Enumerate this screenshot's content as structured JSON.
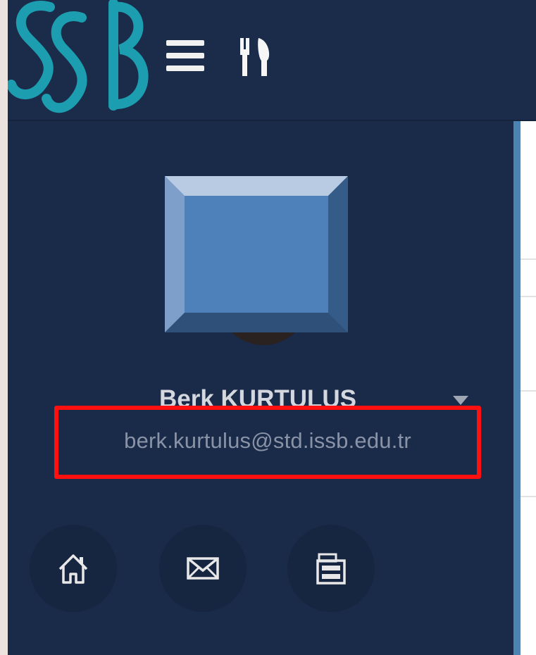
{
  "header": {
    "logo": {
      "text": "SSB",
      "color": "#1c9db0",
      "icon": "ssb-logo"
    },
    "menu_icon": "hamburger-menu-icon",
    "dining_icon": "fork-knife-icon"
  },
  "sidebar": {
    "user": {
      "name": "Berk KURTULUS",
      "email": "berk.kurtulus@std.issb.edu.tr",
      "avatar_icon": "profile-picture-placeholder"
    },
    "dropdown_icon": "caret-down-icon",
    "nav_buttons": [
      {
        "icon": "home-icon"
      },
      {
        "icon": "mail-icon"
      },
      {
        "icon": "archive-icon"
      }
    ]
  },
  "colors": {
    "sidebar_bg": "#1a2a49",
    "highlight_border": "#ff1010",
    "accent": "#4d83b2"
  }
}
